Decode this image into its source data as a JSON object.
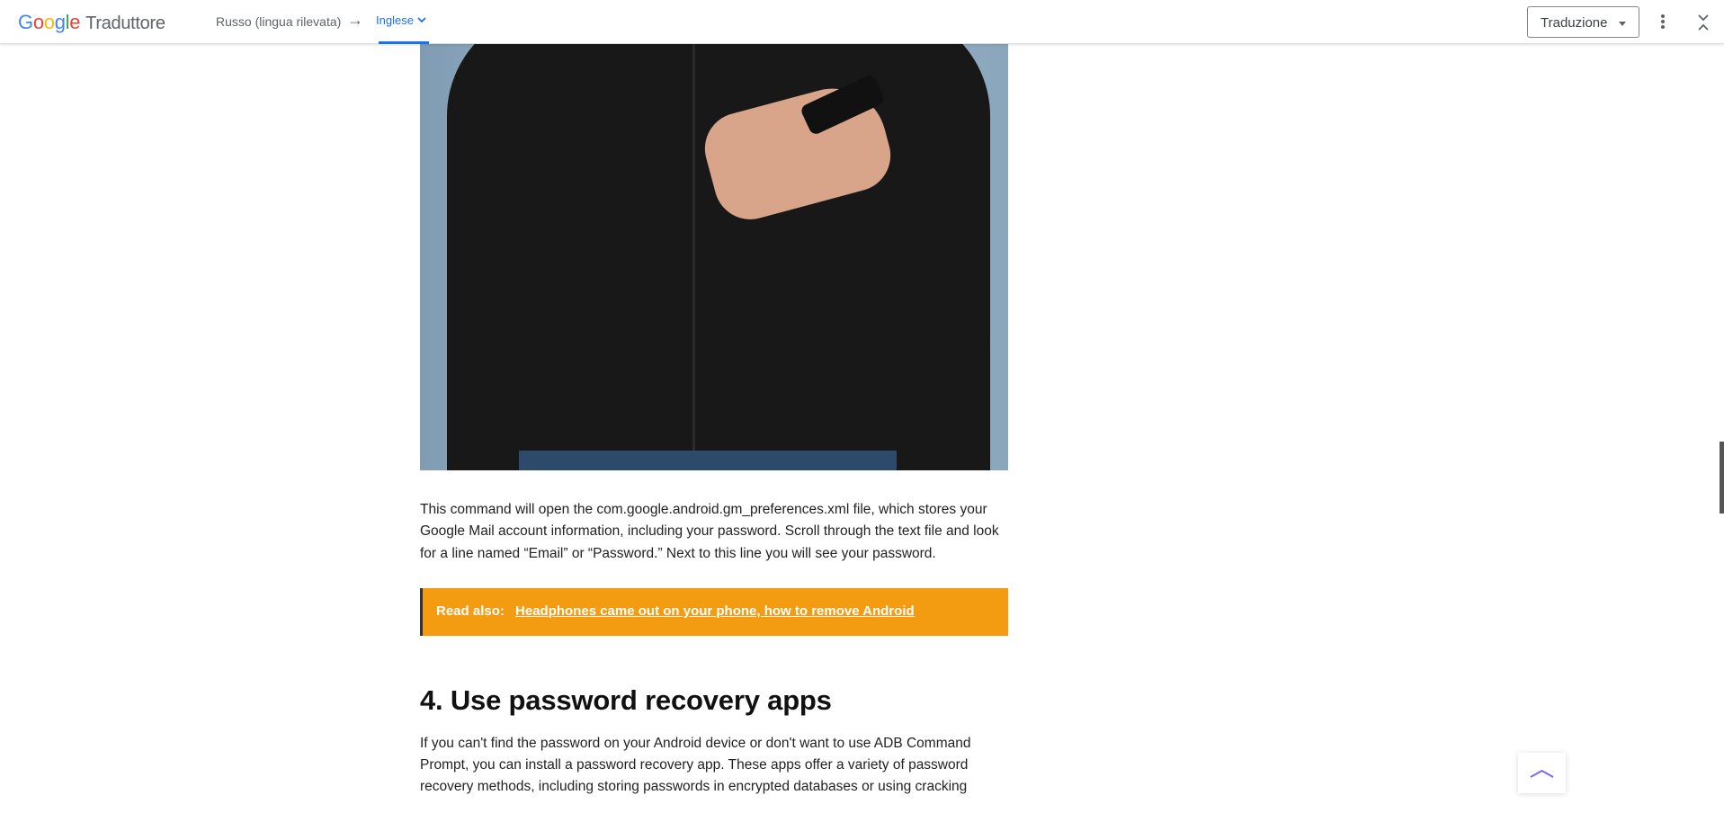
{
  "header": {
    "logo_google": "Google",
    "logo_product": "Traduttore",
    "source_language": "Russo (lingua rilevata)",
    "arrow": "→",
    "target_language": "Inglese",
    "mode_select": "Traduzione"
  },
  "article": {
    "paragraph_1": "This command will open the com.google.android.gm_preferences.xml file, which stores your Google Mail account information, including your password. Scroll through the text file and look for a line named “Email” or “Password.” Next to this line you will see your password.",
    "read_also_label": "Read also:",
    "read_also_link": "Headphones came out on your phone, how to remove Android",
    "heading": "4. Use password recovery apps",
    "paragraph_2": "If you can't find the password on your Android device or don't want to use ADB Command Prompt, you can install a password recovery app. These apps offer a variety of password recovery methods, including storing passwords in encrypted databases or using cracking"
  },
  "colors": {
    "accent_blue": "#1a73e8",
    "read_also_bg": "#f39c12"
  },
  "icons": {
    "target_chevron": "chevron-down-icon",
    "mode_caret": "caret-down-icon",
    "more": "more-vert-icon",
    "collapse": "collapse-icon",
    "scroll_top": "chevron-up-icon"
  }
}
